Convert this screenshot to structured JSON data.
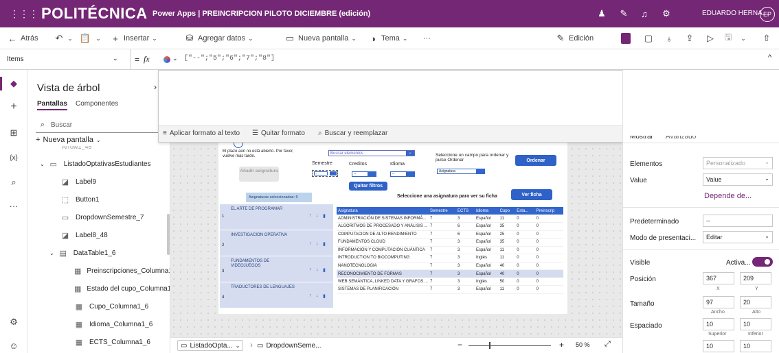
{
  "topbar": {
    "logo": "POLITÉCNICA",
    "app_title": "Power Apps  |  PREINCRIPCION PILOTO DICIEMBRE (edición)",
    "user_name": "EDUARDO HERNA...",
    "user_initials": "EP"
  },
  "toolbar": {
    "back": "Atrás",
    "insert": "Insertar",
    "add_data": "Agregar datos",
    "new_screen": "Nueva pantalla",
    "theme": "Tema",
    "more": "···",
    "edit": "Edición"
  },
  "formula": {
    "property": "Items",
    "fx": "fx",
    "value": "[\"--\";\"5\";\"6\";\"7\";\"8\"]"
  },
  "expanded": {
    "format_text": "Aplicar formato al texto",
    "remove_format": "Quitar formato",
    "find_replace": "Buscar y reemplazar"
  },
  "tree": {
    "title": "Vista de árbol",
    "tab_screens": "Pantallas",
    "tab_components": "Componentes",
    "search_placeholder": "Buscar",
    "new_screen": "Nueva pantalla",
    "partial": "Arrow1_45",
    "items": [
      {
        "label": "ListadoOptativasEstudiantes",
        "icon": "screen-icon"
      },
      {
        "label": "Label9",
        "icon": "label-icon"
      },
      {
        "label": "Button1",
        "icon": "button-icon"
      },
      {
        "label": "DropdownSemestre_7",
        "icon": "dropdown-icon"
      },
      {
        "label": "Label8_48",
        "icon": "label-icon"
      },
      {
        "label": "DataTable1_6",
        "icon": "table-icon"
      },
      {
        "label": "Preinscripciones_Columna1_6",
        "icon": "column-icon"
      },
      {
        "label": "Estado del cupo_Columna1_6",
        "icon": "column-icon"
      },
      {
        "label": "Cupo_Columna1_6",
        "icon": "column-icon"
      },
      {
        "label": "Idioma_Columna1_6",
        "icon": "column-icon"
      },
      {
        "label": "ECTS_Columna1_6",
        "icon": "column-icon"
      }
    ]
  },
  "app": {
    "notice": "El plazo aún no está abierto. Por favor, vuelve más tarde.",
    "search_box": "Buscar elementos",
    "filter_semestre": "Semestre",
    "filter_creditos": "Creditos",
    "filter_idioma": "Idioma",
    "dropdown_empty": "--",
    "sort_prompt": "Seleccione un campo para ordenar y pulse Ordenar",
    "sort_field": "Asignatura",
    "sort_button": "Ordenar",
    "add_button": "Añadir asignatura",
    "clear_filters": "Quitar filtros",
    "selected_count": "Asignaturas seleccionadas: 6",
    "select_prompt": "Seleccione una asignatura para ver su ficha",
    "view_button": "Ver ficha",
    "gallery": [
      {
        "num": "1",
        "title": "EL ARTE DE PROGRAMAR"
      },
      {
        "num": "2",
        "title": "INVESTIGACION OPERATIVA"
      },
      {
        "num": "3",
        "title": "FUNDAMENTOS DE VIDEOJUEGOS"
      },
      {
        "num": "4",
        "title": "TRADUCTORES DE LENGUAJES"
      }
    ],
    "table_headers": [
      "Asignatura",
      "Semestre",
      "ECTS",
      "Idioma",
      "Cupo",
      "Esta...",
      "Preinscrip"
    ],
    "table_rows": [
      [
        "ADMINISTRACIÓN DE SISTEMAS INFORMÁ...",
        "7",
        "3",
        "Español",
        "11",
        "0",
        "0"
      ],
      [
        "ALGORITMOS DE PROCESADO Y ANÁLISIS ...",
        "7",
        "6",
        "Español",
        "35",
        "0",
        "0"
      ],
      [
        "COMPUTACION DE ALTO RENDIMIENTO",
        "7",
        "6",
        "Español",
        "25",
        "0",
        "0"
      ],
      [
        "FUNDAMENTOS CLOUD",
        "7",
        "3",
        "Español",
        "35",
        "0",
        "0"
      ],
      [
        "INFORMACIÓN Y COMPUTACIÓN CUÁNTICA",
        "7",
        "3",
        "Español",
        "11",
        "0",
        "0"
      ],
      [
        "INTRODUCTION TO BIOCOMPUTING",
        "7",
        "3",
        "Inglés",
        "11",
        "0",
        "0"
      ],
      [
        "NANOTECNOLOGIA",
        "7",
        "3",
        "Español",
        "40",
        "0",
        "0"
      ],
      [
        "RECONOCIMIENTO DE FORMAS",
        "7",
        "3",
        "Español",
        "40",
        "0",
        "0"
      ],
      [
        "WEB SEMÁNTICA, LINKED DATA Y GRAFOS ...",
        "7",
        "3",
        "Inglés",
        "50",
        "0",
        "0"
      ],
      [
        "SISTEMAS DE PLANIFICACIÓN",
        "7",
        "3",
        "Español",
        "11",
        "0",
        "0"
      ]
    ],
    "selected_row": 7
  },
  "props": {
    "tab_show": "Mostrar",
    "tab_advanced": "Avanzado",
    "elements_label": "Elementos",
    "elements_value": "Personalizado",
    "value_label": "Value",
    "value_value": "Value",
    "depends": "Depende de...",
    "default_label": "Predeterminado",
    "default_value": "--",
    "mode_label": "Modo de presentaci...",
    "mode_value": "Editar",
    "visible_label": "Visible",
    "visible_value": "Activa...",
    "position_label": "Posición",
    "pos_x": "367",
    "pos_y": "209",
    "x_label": "X",
    "y_label": "Y",
    "size_label": "Tamaño",
    "width": "97",
    "height": "20",
    "width_label": "Ancho",
    "height_label": "Alto",
    "spacing_label": "Espaciado",
    "pad_top": "10",
    "pad_bottom": "10",
    "top_label": "Superior",
    "bottom_label": "Inferior",
    "pad_left": "10",
    "pad_right": "10"
  },
  "bottombar": {
    "screen_crumb": "ListadoOpta...",
    "control_crumb": "DropdownSeme...",
    "zoom": "50 %"
  },
  "colors": {
    "brand": "#742774",
    "accent": "#2e62c8",
    "toggle": "#742774"
  }
}
